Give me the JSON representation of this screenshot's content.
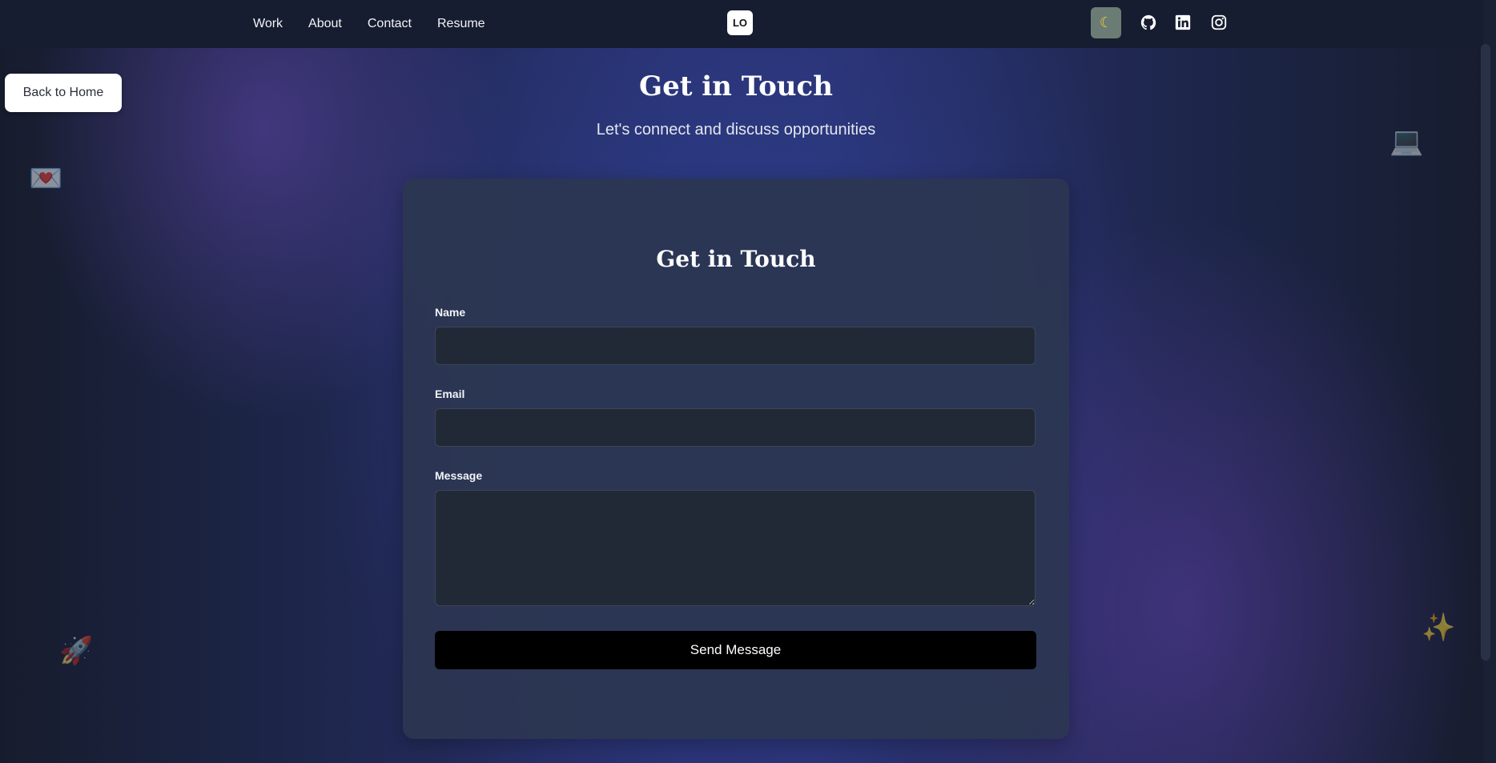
{
  "nav": {
    "links": [
      "Work",
      "About",
      "Contact",
      "Resume"
    ],
    "logo_text": "LO",
    "theme_icon": "moon-icon",
    "social_icons": [
      "github-icon",
      "linkedin-icon",
      "instagram-icon"
    ]
  },
  "back_button_label": "Back to Home",
  "hero": {
    "title": "Get in Touch",
    "subtitle": "Let's connect and discuss opportunities"
  },
  "form": {
    "title": "Get in Touch",
    "name_label": "Name",
    "name_value": "",
    "email_label": "Email",
    "email_value": "",
    "message_label": "Message",
    "message_value": "",
    "submit_label": "Send Message"
  },
  "decorations": [
    "love-letter-icon",
    "laptop-icon",
    "rocket-icon",
    "sparkles-icon"
  ],
  "colors": {
    "nav_background": "#161d30",
    "card_background": "#2c3652",
    "field_background": "#212937",
    "submit_background": "#000000",
    "theme_toggle_background": "#6b7c74"
  }
}
